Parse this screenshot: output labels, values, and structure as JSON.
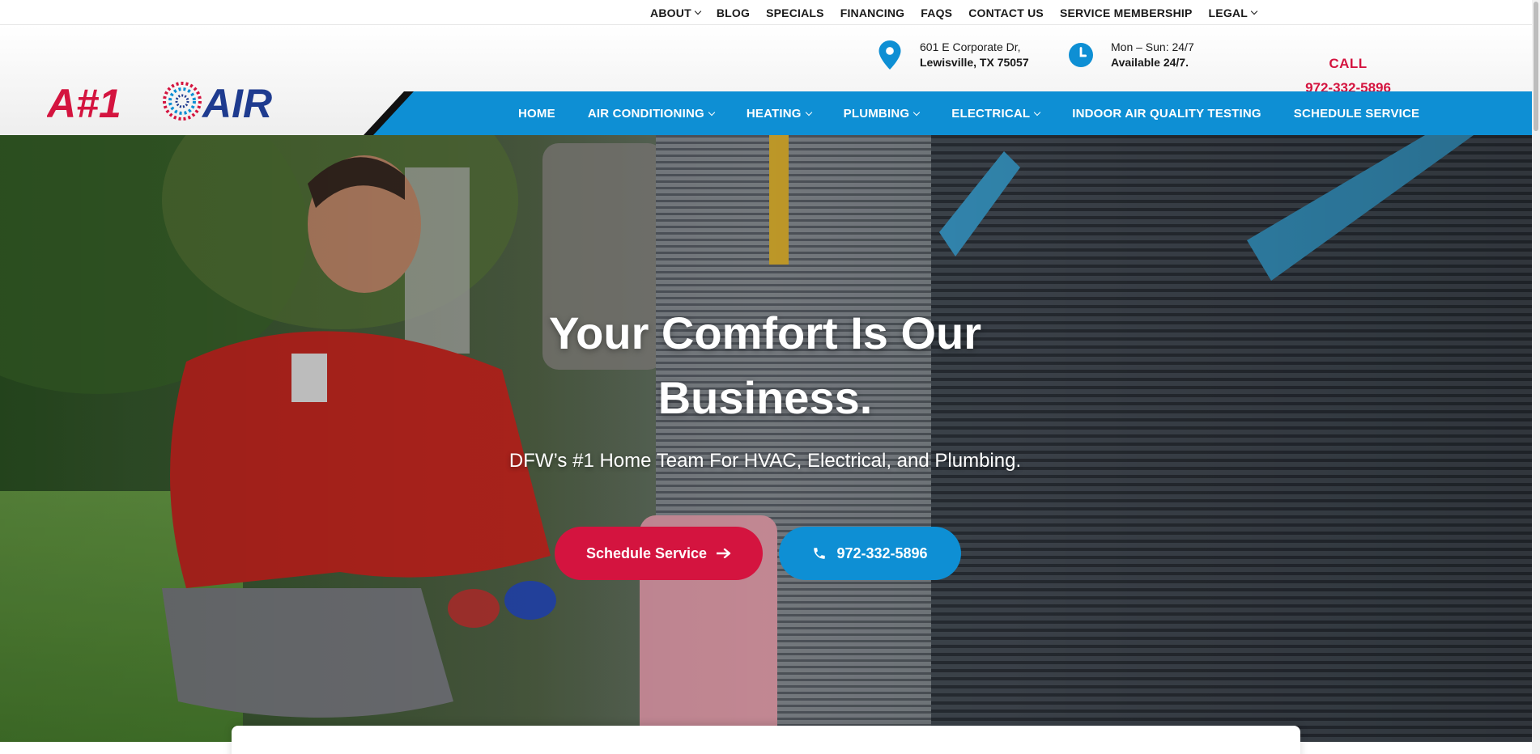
{
  "top_nav": [
    {
      "label": "ABOUT",
      "dropdown": true
    },
    {
      "label": "BLOG",
      "dropdown": false
    },
    {
      "label": "SPECIALS",
      "dropdown": false
    },
    {
      "label": "FINANCING",
      "dropdown": false
    },
    {
      "label": "FAQS",
      "dropdown": false
    },
    {
      "label": "CONTACT US",
      "dropdown": false
    },
    {
      "label": "SERVICE MEMBERSHIP",
      "dropdown": false
    },
    {
      "label": "LEGAL",
      "dropdown": true
    }
  ],
  "logo": {
    "text_left": "A#1",
    "text_right": "AIR"
  },
  "address": {
    "line1": "601 E Corporate Dr,",
    "line2": "Lewisville, TX 75057",
    "icon": "location-pin-icon"
  },
  "hours": {
    "line1": "Mon – Sun: 24/7",
    "line2": "Available 24/7.",
    "icon": "clock-icon"
  },
  "call": {
    "label": "CALL",
    "number": "972-332-5896"
  },
  "main_nav": [
    {
      "label": "HOME",
      "dropdown": false
    },
    {
      "label": "AIR CONDITIONING",
      "dropdown": true
    },
    {
      "label": "HEATING",
      "dropdown": true
    },
    {
      "label": "PLUMBING",
      "dropdown": true
    },
    {
      "label": "ELECTRICAL",
      "dropdown": true
    },
    {
      "label": "INDOOR AIR QUALITY TESTING",
      "dropdown": false
    },
    {
      "label": "SCHEDULE SERVICE",
      "dropdown": false
    }
  ],
  "hero": {
    "title_line1": "Your Comfort Is Our",
    "title_line2": "Business.",
    "subtitle": "DFW’s #1 Home Team For HVAC, Electrical, and Plumbing.",
    "schedule_label": "Schedule Service",
    "call_label": "972-332-5896"
  },
  "colors": {
    "brand_red": "#d4143f",
    "brand_blue": "#0e8fd4",
    "logo_navy": "#1e3b8f"
  }
}
